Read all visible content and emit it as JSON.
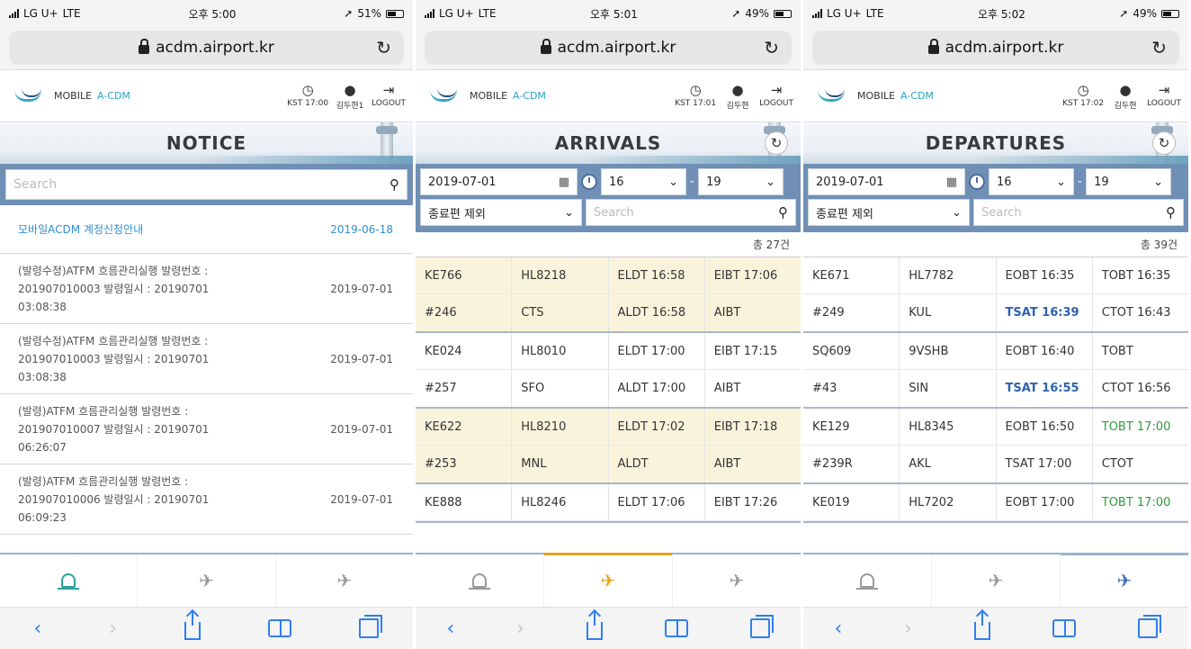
{
  "colors": {
    "accent_blue": "#2e62b0",
    "accent_green": "#2f9a3c",
    "accent_orange": "#e8a21e",
    "filter_bg": "#6f8fb5",
    "highlight_row": "#faf3dc",
    "link_blue": "#2e8fd0"
  },
  "screens": [
    {
      "status": {
        "carrier": "LG U+",
        "network": "LTE",
        "time": "오후 5:00",
        "battery": "51%"
      },
      "url": "acdm.airport.kr",
      "header": {
        "brand_prefix": "MOBILE ",
        "brand_suffix": "A-CDM",
        "clock_label": "KST 17:00",
        "user_label": "김두현1",
        "logout_label": "LOGOUT"
      },
      "title": "NOTICE",
      "search_placeholder": "Search",
      "notices": [
        {
          "title": "모바일ACDM 계정신청안내",
          "date": "2019-06-18"
        },
        {
          "title": "(발령수정)ATFM 흐름관리실행 발령번호 : 201907010003 발령일시 : 20190701 03:08:38",
          "date": "2019-07-01"
        },
        {
          "title": "(발령수정)ATFM 흐름관리실행 발령번호 : 201907010003 발령일시 : 20190701 03:08:38",
          "date": "2019-07-01"
        },
        {
          "title": "(발령)ATFM 흐름관리실행 발령번호 : 201907010007 발령일시 : 20190701 06:26:07",
          "date": "2019-07-01"
        },
        {
          "title": "(발령)ATFM 흐름관리실행 발령번호 : 201907010006 발령일시 : 20190701 06:09:23",
          "date": "2019-07-01"
        }
      ]
    },
    {
      "status": {
        "carrier": "LG U+",
        "network": "LTE",
        "time": "오후 5:01",
        "battery": "49%"
      },
      "url": "acdm.airport.kr",
      "header": {
        "brand_prefix": "MOBILE ",
        "brand_suffix": "A-CDM",
        "clock_label": "KST 17:01",
        "user_label": "김두현",
        "logout_label": "LOGOUT"
      },
      "title": "ARRIVALS",
      "filters": {
        "date": "2019-07-01",
        "hour_from": "16",
        "hour_to": "19",
        "dash": "-",
        "exclude": "종료편 제외",
        "search_placeholder": "Search"
      },
      "count": "총 27건",
      "groups": [
        {
          "highlight": true,
          "rows": [
            [
              "KE766",
              "HL8218",
              "ELDT 16:58",
              "EIBT 17:06"
            ],
            [
              "#246",
              "CTS",
              "ALDT 16:58",
              "AIBT"
            ]
          ]
        },
        {
          "highlight": false,
          "rows": [
            [
              "KE024",
              "HL8010",
              "ELDT 17:00",
              "EIBT 17:15"
            ],
            [
              "#257",
              "SFO",
              "ALDT 17:00",
              "AIBT"
            ]
          ]
        },
        {
          "highlight": true,
          "rows": [
            [
              "KE622",
              "HL8210",
              "ELDT 17:02",
              "EIBT 17:18"
            ],
            [
              "#253",
              "MNL",
              "ALDT",
              "AIBT"
            ]
          ]
        },
        {
          "highlight": false,
          "rows": [
            [
              "KE888",
              "HL8246",
              "ELDT 17:06",
              "EIBT 17:26"
            ]
          ]
        }
      ]
    },
    {
      "status": {
        "carrier": "LG U+",
        "network": "LTE",
        "time": "오후 5:02",
        "battery": "49%"
      },
      "url": "acdm.airport.kr",
      "header": {
        "brand_prefix": "MOBILE ",
        "brand_suffix": "A-CDM",
        "clock_label": "KST 17:02",
        "user_label": "김두현",
        "logout_label": "LOGOUT"
      },
      "title": "DEPARTURES",
      "filters": {
        "date": "2019-07-01",
        "hour_from": "16",
        "hour_to": "19",
        "dash": "-",
        "exclude": "종료편 제외",
        "search_placeholder": "Search"
      },
      "count": "총 39건",
      "groups": [
        {
          "rows": [
            [
              "KE671",
              "HL7782",
              "EOBT 16:35",
              "TOBT 16:35"
            ],
            [
              "#249",
              "KUL",
              "TSAT 16:39",
              "CTOT 16:43"
            ]
          ],
          "styles": [
            [
              "",
              "",
              "",
              ""
            ],
            [
              "",
              "",
              "blue",
              ""
            ]
          ]
        },
        {
          "rows": [
            [
              "SQ609",
              "9VSHB",
              "EOBT 16:40",
              "TOBT"
            ],
            [
              "#43",
              "SIN",
              "TSAT 16:55",
              "CTOT 16:56"
            ]
          ],
          "styles": [
            [
              "",
              "",
              "",
              ""
            ],
            [
              "",
              "",
              "blue",
              ""
            ]
          ]
        },
        {
          "rows": [
            [
              "KE129",
              "HL8345",
              "EOBT 16:50",
              "TOBT 17:00"
            ],
            [
              "#239R",
              "AKL",
              "TSAT 17:00",
              "CTOT"
            ]
          ],
          "styles": [
            [
              "",
              "",
              "",
              "green"
            ],
            [
              "",
              "",
              "",
              ""
            ]
          ]
        },
        {
          "rows": [
            [
              "KE019",
              "HL7202",
              "EOBT 17:00",
              "TOBT 17:00"
            ]
          ],
          "styles": [
            [
              "",
              "",
              "",
              "green"
            ]
          ]
        }
      ]
    }
  ],
  "tabs": [
    {
      "icon": "bell-icon"
    },
    {
      "icon": "arrival-plane-icon"
    },
    {
      "icon": "departure-plane-icon"
    }
  ],
  "safari_toolbar": [
    "back",
    "forward",
    "share",
    "bookmarks",
    "tabs"
  ]
}
